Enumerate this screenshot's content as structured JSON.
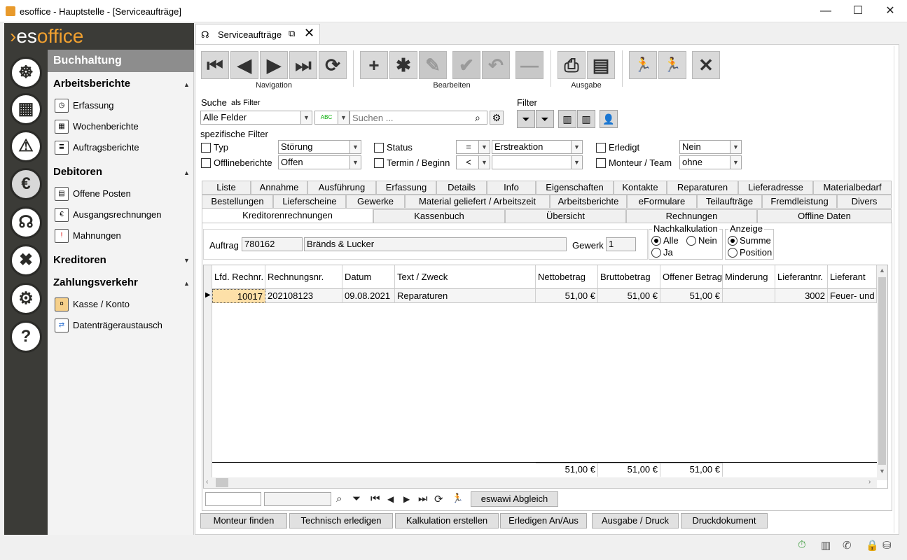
{
  "window": {
    "title": "esoffice - Hauptstelle - [Serviceaufträge]",
    "minimize": "—",
    "maximize": "☐",
    "close": "✕"
  },
  "logo": {
    "prefix": "›",
    "brand_a": "es",
    "brand_b": "office"
  },
  "sidebar": {
    "header": "Buchhaltung",
    "sections": [
      {
        "title": "Arbeitsberichte",
        "arrow": "▲",
        "items": [
          {
            "label": "Erfassung",
            "icon": "clock-report-icon"
          },
          {
            "label": "Wochenberichte",
            "icon": "calendar-icon"
          },
          {
            "label": "Auftragsberichte",
            "icon": "report-list-icon"
          }
        ]
      },
      {
        "title": "Debitoren",
        "arrow": "▲",
        "items": [
          {
            "label": "Offene Posten",
            "icon": "document-icon"
          },
          {
            "label": "Ausgangsrechnungen",
            "icon": "invoice-icon"
          },
          {
            "label": "Mahnungen",
            "icon": "reminder-icon"
          }
        ]
      },
      {
        "title": "Kreditoren",
        "arrow": "▼",
        "items": []
      },
      {
        "title": "Zahlungsverkehr",
        "arrow": "▲",
        "items": [
          {
            "label": "Kasse / Konto",
            "icon": "cash-icon"
          },
          {
            "label": "Datenträgeraustausch",
            "icon": "data-exchange-icon"
          }
        ]
      }
    ]
  },
  "module_icons": [
    "helm-icon",
    "calculator-icon",
    "alarm-light-icon",
    "money-icon",
    "headset-icon",
    "tools-icon",
    "gears-icon",
    "help-icon"
  ],
  "doctab": {
    "label": "Serviceaufträge",
    "icon": "headset-icon"
  },
  "toolbar": {
    "navigation_label": "Navigation",
    "bearbeiten_label": "Bearbeiten",
    "ausgabe_label": "Ausgabe",
    "glyphs": {
      "first": "⏮",
      "prev": "◀",
      "next": "▶",
      "last": "⏭",
      "refresh": "⟳",
      "add": "+",
      "multi": "✱",
      "edit": "✎",
      "save": "✔",
      "undo": "↶",
      "delete": "—",
      "print": "⎙",
      "export": "▤",
      "run1": "🏃",
      "run2": "🏃",
      "close": "✕"
    }
  },
  "search": {
    "label": "Suche",
    "as_filter": "als Filter",
    "field_value": "Alle Felder",
    "abc": "ABC",
    "placeholder": "Suchen ...",
    "filter_label": "Filter"
  },
  "filters": {
    "title": "spezifische Filter",
    "typ_label": "Typ",
    "typ_value": "Störung",
    "offline_label": "Offlineberichte",
    "offline_value": "Offen",
    "status_label": "Status",
    "status_op": "=",
    "status_value": "Erstreaktion",
    "termin_label": "Termin / Beginn",
    "termin_op": "<",
    "termin_value": "",
    "erledigt_label": "Erledigt",
    "erledigt_value": "Nein",
    "monteur_label": "Monteur / Team",
    "monteur_value": "ohne"
  },
  "tabs_row1": [
    "Liste",
    "Annahme",
    "Ausführung",
    "Erfassung",
    "Details",
    "Info",
    "Eigenschaften",
    "Kontakte",
    "Reparaturen",
    "Lieferadresse",
    "Materialbedarf"
  ],
  "tabs_row2": [
    "Bestellungen",
    "Lieferscheine",
    "Gewerke",
    "Material geliefert / Arbeitszeit",
    "Arbeitsberichte",
    "eFormulare",
    "Teilaufträge",
    "Fremdleistung",
    "Divers"
  ],
  "tabs_row3": [
    "Kreditorenrechnungen",
    "Kassenbuch",
    "Übersicht",
    "Rechnungen",
    "Offline Daten"
  ],
  "auftrag": {
    "label": "Auftrag",
    "number": "780162",
    "name": "Bränds & Lucker",
    "gewerk_label": "Gewerk",
    "gewerk_value": "1"
  },
  "nachkalkulation": {
    "title": "Nachkalkulation",
    "alle": "Alle",
    "nein": "Nein",
    "ja": "Ja",
    "selected": "Alle"
  },
  "anzeige": {
    "title": "Anzeige",
    "summe": "Summe",
    "position": "Position",
    "selected": "Summe"
  },
  "grid": {
    "columns": [
      "Lfd. Rechnr.",
      "Rechnungsnr.",
      "Datum",
      "Text / Zweck",
      "Nettobetrag",
      "Bruttobetrag",
      "Offener Betrag",
      "Minderung",
      "Lieferantnr.",
      "Lieferant"
    ],
    "rows": [
      [
        "10017",
        "202108123",
        "09.08.2021",
        "Reparaturen",
        "51,00 €",
        "51,00 €",
        "51,00 €",
        "",
        "3002",
        "Feuer- und I"
      ]
    ],
    "footer": {
      "netto": "51,00 €",
      "brutto": "51,00 €",
      "offen": "51,00 €"
    },
    "row_indicator": "▶"
  },
  "bottom_nav": {
    "search_icon": "⌕",
    "filter_icon": "⏷",
    "first": "⏮",
    "prev": "◀",
    "next": "▶",
    "last": "⏭",
    "refresh": "⟳",
    "run": "🏃",
    "eswawi_label": "eswawi Abgleich"
  },
  "actions": [
    "Monteur finden",
    "Technisch erledigen",
    "Kalkulation erstellen",
    "Erledigen An/Aus",
    "Ausgabe / Druck",
    "Druckdokument"
  ],
  "status_icons": [
    "timer-icon",
    "building-icon",
    "phone-icon",
    "lock-icon",
    "database-icon"
  ]
}
